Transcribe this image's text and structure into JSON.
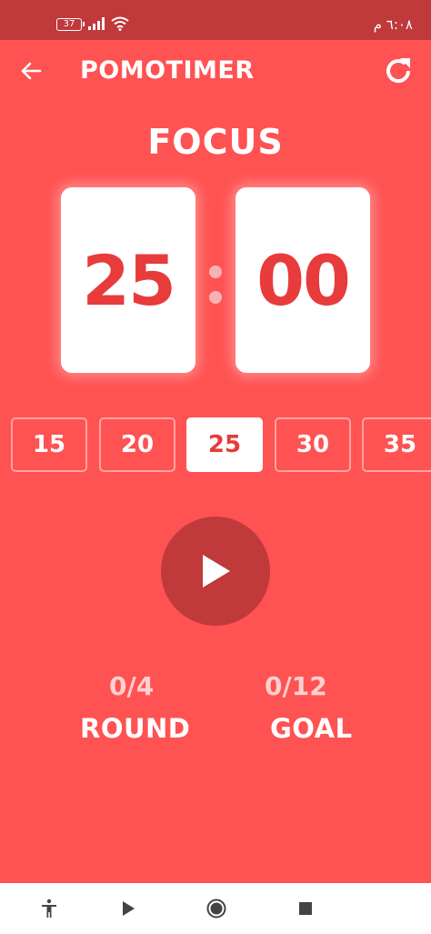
{
  "status_bar": {
    "battery": "37",
    "time": "٦:٠٨ م"
  },
  "app_bar": {
    "title": "POMOTIMER",
    "back_icon": "arrow-left-icon",
    "refresh_icon": "refresh-icon"
  },
  "timer": {
    "mode": "FOCUS",
    "minutes": "25",
    "seconds": "00"
  },
  "presets": [
    {
      "label": "15",
      "active": false
    },
    {
      "label": "20",
      "active": false
    },
    {
      "label": "25",
      "active": true
    },
    {
      "label": "30",
      "active": false
    },
    {
      "label": "35",
      "active": false
    }
  ],
  "play_icon": "play-icon",
  "stats": {
    "round": {
      "value": "0/4",
      "label": "ROUND"
    },
    "goal": {
      "value": "0/12",
      "label": "GOAL"
    }
  },
  "colors": {
    "background": "#ff5252",
    "status_bar": "#c0393b",
    "play_button": "#c0393b",
    "digit": "#e83b3b"
  },
  "nav_bar": {
    "icons": [
      "accessibility-icon",
      "play-nav-icon",
      "home-icon",
      "stop-icon"
    ]
  }
}
